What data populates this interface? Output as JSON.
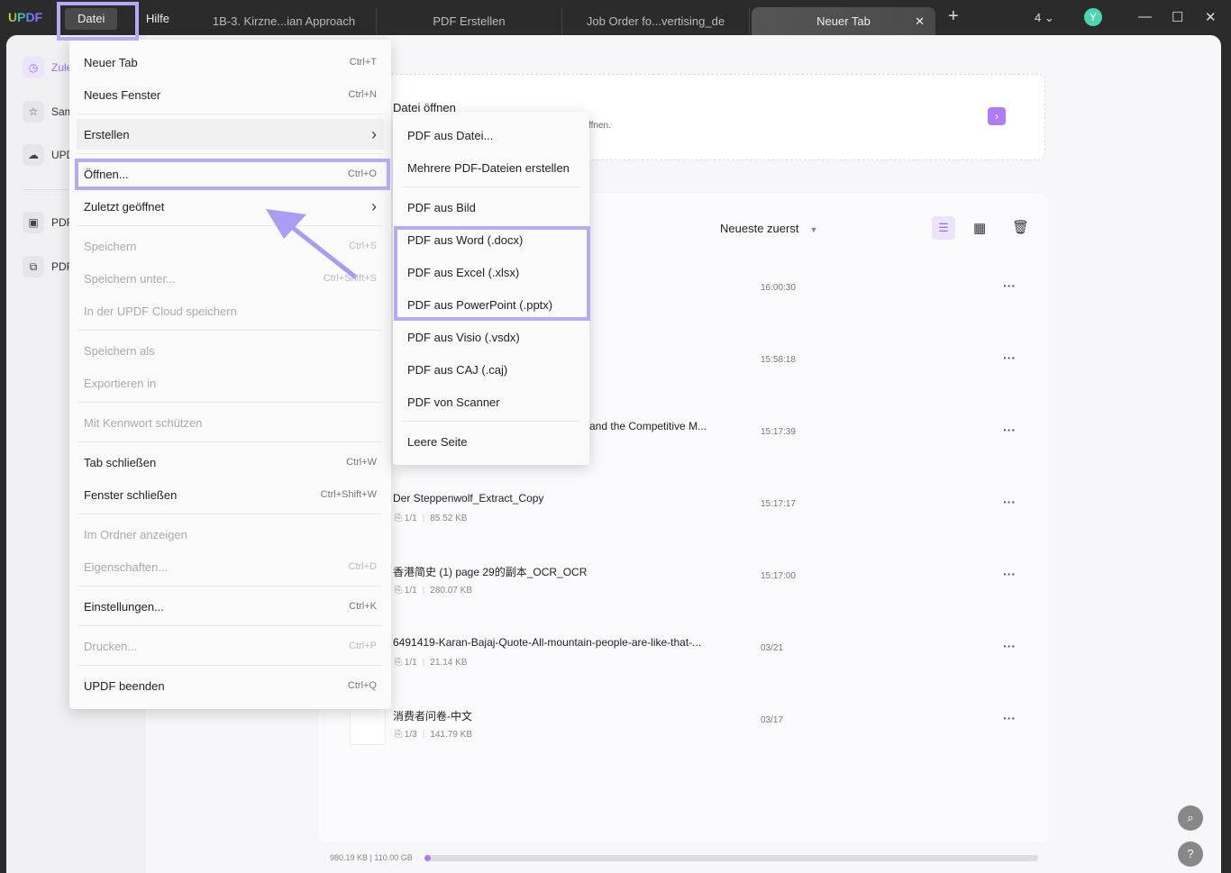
{
  "app": {
    "logo": "UPDF"
  },
  "menubar": {
    "file": "Datei",
    "help": "Hilfe"
  },
  "tabs": [
    {
      "label": "1B-3. Kirzne...ian Approach"
    },
    {
      "label": "PDF Erstellen"
    },
    {
      "label": "Job Order fo...vertising_de"
    },
    {
      "label": "Neuer Tab",
      "active": true
    }
  ],
  "window": {
    "tab_count": "4",
    "avatar": "Y",
    "avatar_color": "#4dd4b0"
  },
  "sidebar": {
    "items": [
      {
        "label": "Zule",
        "icon": "clock-icon"
      },
      {
        "label": "Sam",
        "icon": "star-icon"
      },
      {
        "label": "UPD",
        "icon": "cloud-icon"
      },
      {
        "label": "PDF",
        "icon": "toolbox-icon"
      },
      {
        "label": "PDF",
        "icon": "copy-icon"
      }
    ]
  },
  "open_card": {
    "title": "Datei öffnen",
    "subtitle_fragment": "ffnen."
  },
  "list": {
    "sort": "Neueste zuerst",
    "rows": [
      {
        "title": "",
        "time": "16:00:30"
      },
      {
        "title": "",
        "time": "15:58:18"
      },
      {
        "title": "and the Competitive M...",
        "time": "15:17:39"
      },
      {
        "title": "Der Steppenwolf_Extract_Copy",
        "pages": "1/1",
        "size": "85.52 KB",
        "time": "15:17:17"
      },
      {
        "title": "香港简史 (1)  page 29的副本_OCR_OCR",
        "pages": "1/1",
        "size": "280.07 KB",
        "time": "15:17:00"
      },
      {
        "title": "6491419-Karan-Bajaj-Quote-All-mountain-people-are-like-that-...",
        "pages": "1/1",
        "size": "21.14 KB",
        "time": "03/21"
      },
      {
        "title": "消费者问卷-中文",
        "pages": "1/3",
        "size": "141.79 KB",
        "time": "03/17"
      }
    ]
  },
  "storage": {
    "text": "980.19 KB | 110.00 GB",
    "used_fraction": 0.01
  },
  "file_menu": {
    "items": [
      {
        "label": "Neuer Tab",
        "shortcut": "Ctrl+T"
      },
      {
        "label": "Neues Fenster",
        "shortcut": "Ctrl+N"
      },
      {
        "label": "Erstellen",
        "shortcut": "›"
      },
      {
        "label": "Öffnen...",
        "shortcut": "Ctrl+O"
      },
      {
        "label": "Zuletzt geöffnet",
        "shortcut": "›"
      },
      {
        "label": "Speichern",
        "shortcut": "Ctrl+S"
      },
      {
        "label": "Speichern unter...",
        "shortcut": "Ctrl+Shift+S"
      },
      {
        "label": "In der UPDF Cloud speichern",
        "shortcut": ""
      },
      {
        "label": "Speichern als",
        "shortcut": ""
      },
      {
        "label": "Exportieren in",
        "shortcut": ""
      },
      {
        "label": "Mit Kennwort schützen",
        "shortcut": ""
      },
      {
        "label": "Tab schließen",
        "shortcut": "Ctrl+W"
      },
      {
        "label": "Fenster schließen",
        "shortcut": "Ctrl+Shift+W"
      },
      {
        "label": "Im Ordner anzeigen",
        "shortcut": ""
      },
      {
        "label": "Eigenschaften...",
        "shortcut": "Ctrl+D"
      },
      {
        "label": "Einstellungen...",
        "shortcut": "Ctrl+K"
      },
      {
        "label": "Drucken...",
        "shortcut": "Ctrl+P"
      },
      {
        "label": "UPDF beenden",
        "shortcut": "Ctrl+Q"
      }
    ]
  },
  "create_menu": {
    "items": [
      "PDF aus Datei...",
      "Mehrere PDF-Dateien erstellen",
      "PDF aus Bild",
      "PDF aus Word (.docx)",
      "PDF aus Excel (.xlsx)",
      "PDF aus PowerPoint (.pptx)",
      "PDF aus Visio (.vsdx)",
      "PDF aus CAJ (.caj)",
      "PDF von Scanner",
      "Leere Seite"
    ]
  },
  "colors": {
    "accent": "#b07cf5",
    "highlight": "#b4aaf5"
  }
}
